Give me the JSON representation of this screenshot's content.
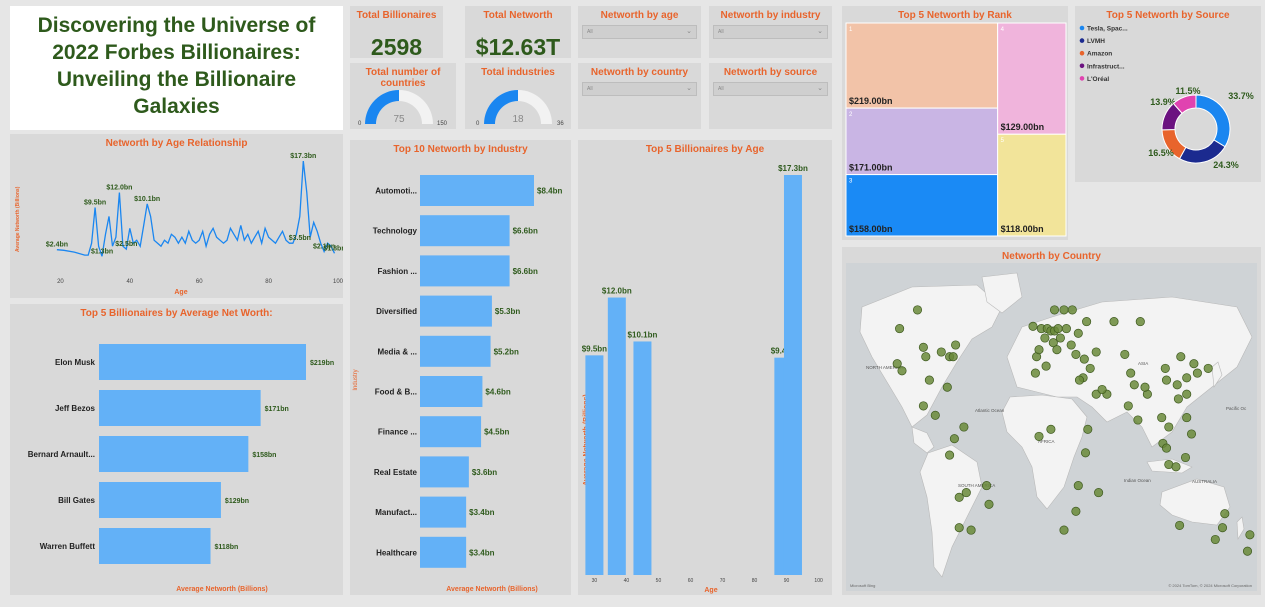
{
  "title": "Discovering the Universe of 2022 Forbes Billionaires: Unveiling the Billionaire Galaxies",
  "kpis": {
    "billionaires": {
      "label": "Total Billionaires",
      "value": "2598"
    },
    "networth": {
      "label": "Total Networth",
      "value": "$12.63T"
    }
  },
  "gauges": {
    "countries": {
      "label": "Total number of countries",
      "value": 75,
      "min": "0",
      "max": "150",
      "value_text": "75"
    },
    "industries": {
      "label": "Total industries",
      "value": 18,
      "min": "0",
      "max": "36",
      "value_text": "18"
    }
  },
  "slicers": [
    {
      "label": "Networth by age",
      "value": "All"
    },
    {
      "label": "Networth by industry",
      "value": "All"
    },
    {
      "label": "Networth by country",
      "value": "All"
    },
    {
      "label": "Networth by source",
      "value": "All"
    }
  ],
  "colors": {
    "bar": "#63b1f7",
    "kpi": "#2e5a1c",
    "title": "#e8642c",
    "gauge": "#1a86f0"
  },
  "chart_data": [
    {
      "id": "age_line",
      "type": "line",
      "title": "Networth by Age Relationship",
      "xlabel": "Age",
      "ylabel": "Average Networth (Billions)",
      "xlim": [
        17,
        100
      ],
      "ylim": [
        0,
        18.5
      ],
      "xticks": [
        "20",
        "40",
        "60",
        "80",
        "100"
      ],
      "x": [
        19,
        21,
        24,
        27,
        28,
        29,
        30,
        31,
        32,
        33,
        34,
        35,
        36,
        37,
        38,
        39,
        40,
        41,
        42,
        43,
        44,
        45,
        46,
        47,
        48,
        49,
        50,
        51,
        52,
        53,
        54,
        55,
        56,
        57,
        58,
        59,
        60,
        61,
        62,
        63,
        64,
        65,
        66,
        67,
        68,
        69,
        70,
        71,
        72,
        73,
        74,
        75,
        76,
        77,
        78,
        79,
        80,
        81,
        82,
        83,
        84,
        85,
        86,
        87,
        88,
        89,
        90,
        91,
        92,
        93,
        94,
        95,
        96,
        97,
        98,
        99
      ],
      "y": [
        2.4,
        2.3,
        2.0,
        1.5,
        1.5,
        3.5,
        9.5,
        3.0,
        1.3,
        5.0,
        8.0,
        3.0,
        4.5,
        12.0,
        3.0,
        2.5,
        6.0,
        3.5,
        4.0,
        3.0,
        6.5,
        10.1,
        8.0,
        4.0,
        3.5,
        3.0,
        4.0,
        3.5,
        5.0,
        4.5,
        3.5,
        4.5,
        3.5,
        5.5,
        4.0,
        3.5,
        4.0,
        5.5,
        3.0,
        5.0,
        6.0,
        4.5,
        4.0,
        3.5,
        4.0,
        6.0,
        5.0,
        4.0,
        6.5,
        4.0,
        5.0,
        3.5,
        4.5,
        5.5,
        3.5,
        6.0,
        4.5,
        4.0,
        3.5,
        4.5,
        5.5,
        4.0,
        3.5,
        3.5,
        5.0,
        8.0,
        17.3,
        12.0,
        4.5,
        7.0,
        5.5,
        3.5,
        2.1,
        3.5,
        3.0,
        1.8
      ],
      "labels": [
        {
          "text": "$2.4bn",
          "x": 19,
          "y": 2.4
        },
        {
          "text": "$1.3bn",
          "x": 32,
          "y": 1.3
        },
        {
          "text": "$9.5bn",
          "x": 30,
          "y": 9.5
        },
        {
          "text": "$12.0bn",
          "x": 37,
          "y": 12.0
        },
        {
          "text": "$2.5bn",
          "x": 39,
          "y": 2.5
        },
        {
          "text": "$10.1bn",
          "x": 45,
          "y": 10.1
        },
        {
          "text": "$17.3bn",
          "x": 90,
          "y": 17.3
        },
        {
          "text": "$3.5bn",
          "x": 89,
          "y": 3.5
        },
        {
          "text": "$2.1bn",
          "x": 96,
          "y": 2.1
        },
        {
          "text": "$1.8bn",
          "x": 99,
          "y": 1.8
        }
      ]
    },
    {
      "id": "top5_people",
      "type": "bar",
      "orientation": "horizontal",
      "title": "Top 5 Billionaires by Average Net Worth:",
      "xlabel": "Average Networth (Billions)",
      "categories": [
        "Elon Musk",
        "Jeff Bezos",
        "Bernard Arnault...",
        "Bill Gates",
        "Warren Buffett"
      ],
      "values": [
        219,
        171,
        158,
        129,
        118
      ],
      "data_labels": [
        "$219bn",
        "$171bn",
        "$158bn",
        "$129bn",
        "$118bn"
      ],
      "xlim": [
        0,
        219
      ]
    },
    {
      "id": "top10_industry",
      "type": "bar",
      "orientation": "horizontal",
      "title": "Top 10 Networth by Industry",
      "xlabel": "Average Networth (Billions)",
      "ylabel": "Industry",
      "categories": [
        "Automoti...",
        "Technology",
        "Fashion ...",
        "Diversified",
        "Media & ...",
        "Food & B...",
        "Finance ...",
        "Real Estate",
        "Manufact...",
        "Healthcare"
      ],
      "values": [
        8.4,
        6.6,
        6.6,
        5.3,
        5.2,
        4.6,
        4.5,
        3.6,
        3.4,
        3.4
      ],
      "data_labels": [
        "$8.4bn",
        "$6.6bn",
        "$6.6bn",
        "$5.3bn",
        "$5.2bn",
        "$4.6bn",
        "$4.5bn",
        "$3.6bn",
        "$3.4bn",
        "$3.4bn"
      ],
      "xlim": [
        0,
        8.4
      ]
    },
    {
      "id": "top5_age",
      "type": "bar",
      "orientation": "vertical",
      "title": "Top 5 Billionaires by Age",
      "xlabel": "Age",
      "ylabel": "Average Networth (Billions)",
      "x": [
        30,
        37,
        45,
        89,
        92
      ],
      "values": [
        9.5,
        12.0,
        10.1,
        9.4,
        17.3
      ],
      "data_labels": [
        "$9.5bn",
        "$12.0bn",
        "$10.1bn",
        "$9.4bn",
        "$17.3bn"
      ],
      "xlim": [
        28,
        102
      ],
      "ylim": [
        0,
        17.3
      ],
      "xticks": [
        "30",
        "40",
        "50",
        "60",
        "70",
        "80",
        "90",
        "100"
      ]
    },
    {
      "id": "rank_treemap",
      "type": "treemap",
      "title": "Top 5 Networth by Rank",
      "items": [
        {
          "rank": "1",
          "value": 219,
          "label": "$219.00bn",
          "color": "#f2c3a8"
        },
        {
          "rank": "2",
          "value": 171,
          "label": "$171.00bn",
          "color": "#c9b5e4"
        },
        {
          "rank": "3",
          "value": 158,
          "label": "$158.00bn",
          "color": "#1a8af5"
        },
        {
          "rank": "4",
          "value": 129,
          "label": "$129.00bn",
          "color": "#f0b4dc"
        },
        {
          "rank": "5",
          "value": 118,
          "label": "$118.00bn",
          "color": "#f2e49a"
        }
      ]
    },
    {
      "id": "source_donut",
      "type": "pie",
      "title": "Top 5 Networth by Source",
      "categories": [
        "Tesla, Spac...",
        "LVMH",
        "Amazon",
        "Infrastruct...",
        "L'Oréal"
      ],
      "values": [
        33.7,
        24.3,
        16.5,
        13.9,
        11.5
      ],
      "data_labels": [
        "33.7%",
        "24.3%",
        "16.5%",
        "13.9%",
        "11.5%"
      ],
      "colors": [
        "#1a86f0",
        "#1b2a8f",
        "#e8642c",
        "#6b1280",
        "#e043b0"
      ]
    },
    {
      "id": "country_map",
      "type": "map",
      "title": "Networth by Country",
      "map_labels": [
        "NORTH AMERICA",
        "ASIA",
        "AFRICA",
        "SOUTH AMERICA",
        "AUSTRALIA",
        "Atlantic Ocean",
        "Indian Ocean",
        "Pacific Oc"
      ],
      "attribution": "© 2024 TomTom, © 2024 Microsoft Corporation",
      "points": [
        [
          -98,
          40
        ],
        [
          -95,
          30
        ],
        [
          -100,
          44
        ],
        [
          -118,
          34
        ],
        [
          -122,
          37
        ],
        [
          -85,
          42
        ],
        [
          -78,
          40
        ],
        [
          -80,
          27
        ],
        [
          -73,
          45
        ],
        [
          -75,
          40
        ],
        [
          -120,
          52
        ],
        [
          -105,
          60
        ],
        [
          -100,
          19
        ],
        [
          -90,
          15
        ],
        [
          -66,
          10
        ],
        [
          -74,
          5
        ],
        [
          -78,
          -2
        ],
        [
          -70,
          -20
        ],
        [
          -47,
          -15
        ],
        [
          -45,
          -23
        ],
        [
          -60,
          -34
        ],
        [
          -70,
          -33
        ],
        [
          -64,
          -18
        ],
        [
          -5,
          40
        ],
        [
          -3,
          43
        ],
        [
          2,
          48
        ],
        [
          -1,
          52
        ],
        [
          -8,
          53
        ],
        [
          4,
          52
        ],
        [
          7,
          51
        ],
        [
          10,
          51
        ],
        [
          13,
          52
        ],
        [
          9,
          46
        ],
        [
          12,
          43
        ],
        [
          15,
          48
        ],
        [
          20,
          52
        ],
        [
          18,
          60
        ],
        [
          10,
          60
        ],
        [
          25,
          60
        ],
        [
          24,
          45
        ],
        [
          28,
          41
        ],
        [
          35,
          39
        ],
        [
          30,
          50
        ],
        [
          37,
          55
        ],
        [
          45,
          42
        ],
        [
          40,
          35
        ],
        [
          34,
          31
        ],
        [
          45,
          24
        ],
        [
          54,
          24
        ],
        [
          50,
          26
        ],
        [
          31,
          30
        ],
        [
          3,
          36
        ],
        [
          -6,
          33
        ],
        [
          -3,
          6
        ],
        [
          7,
          9
        ],
        [
          38,
          9
        ],
        [
          36,
          -1
        ],
        [
          18,
          -34
        ],
        [
          28,
          -26
        ],
        [
          47,
          -18
        ],
        [
          30,
          -15
        ],
        [
          69,
          41
        ],
        [
          77,
          28
        ],
        [
          72,
          19
        ],
        [
          80,
          13
        ],
        [
          88,
          24
        ],
        [
          74,
          33
        ],
        [
          60,
          55
        ],
        [
          82,
          55
        ],
        [
          103,
          35
        ],
        [
          116,
          40
        ],
        [
          121,
          31
        ],
        [
          114,
          22
        ],
        [
          113,
          28
        ],
        [
          104,
          30
        ],
        [
          127,
          37
        ],
        [
          139,
          35
        ],
        [
          130,
          33
        ],
        [
          121,
          24
        ],
        [
          121,
          14
        ],
        [
          100,
          14
        ],
        [
          106,
          10
        ],
        [
          101,
          3
        ],
        [
          104,
          1
        ],
        [
          106,
          -6
        ],
        [
          112,
          -7
        ],
        [
          125,
          7
        ],
        [
          120,
          -3
        ],
        [
          86,
          27
        ],
        [
          151,
          -33
        ],
        [
          145,
          -38
        ],
        [
          115,
          -32
        ],
        [
          153,
          -27
        ],
        [
          174,
          -36
        ],
        [
          172,
          -43
        ]
      ]
    }
  ]
}
